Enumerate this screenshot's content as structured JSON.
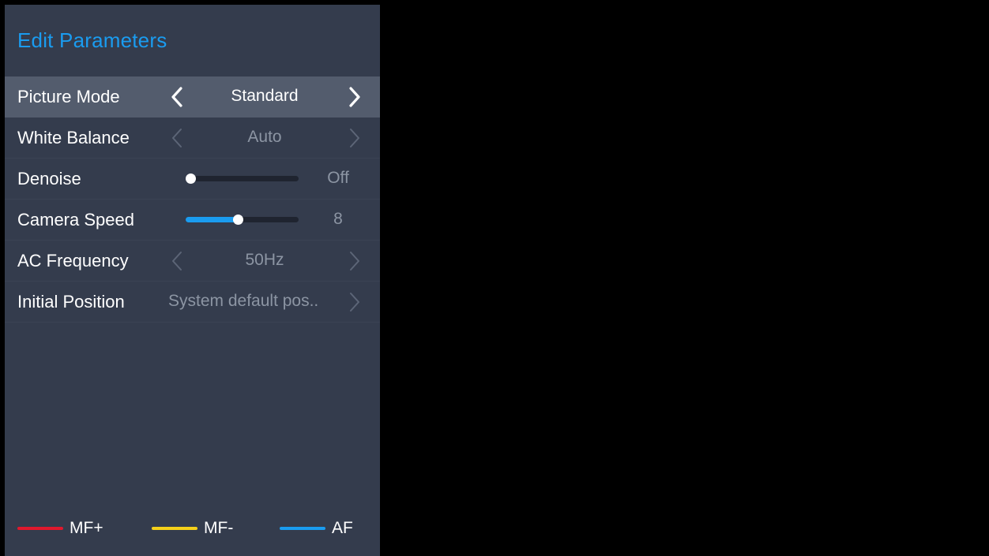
{
  "panel": {
    "title": "Edit Parameters",
    "accent_color": "#1a9cf0",
    "background_color": "#343c4d",
    "selected_row_color": "#535c6d"
  },
  "rows": {
    "picture_mode": {
      "label": "Picture Mode",
      "value": "Standard",
      "selected": true,
      "prev_icon": "chevron-left-icon",
      "next_icon": "chevron-right-icon"
    },
    "white_balance": {
      "label": "White Balance",
      "value": "Auto",
      "prev_icon": "chevron-left-icon",
      "next_icon": "chevron-right-icon"
    },
    "denoise": {
      "label": "Denoise",
      "value": "Off",
      "level": 0.0
    },
    "camera_speed": {
      "label": "Camera Speed",
      "value": "8",
      "level": 0.46
    },
    "ac_frequency": {
      "label": "AC Frequency",
      "value": "50Hz",
      "prev_icon": "chevron-left-icon",
      "next_icon": "chevron-right-icon"
    },
    "initial_position": {
      "label": "Initial Position",
      "value": "System default pos..",
      "next_icon": "chevron-right-icon"
    }
  },
  "legend": {
    "mf_plus": {
      "label": "MF+",
      "color": "#e0182d"
    },
    "mf_minus": {
      "label": "MF-",
      "color": "#f5d01a"
    },
    "af": {
      "label": "AF",
      "color": "#1a9cf0"
    }
  }
}
